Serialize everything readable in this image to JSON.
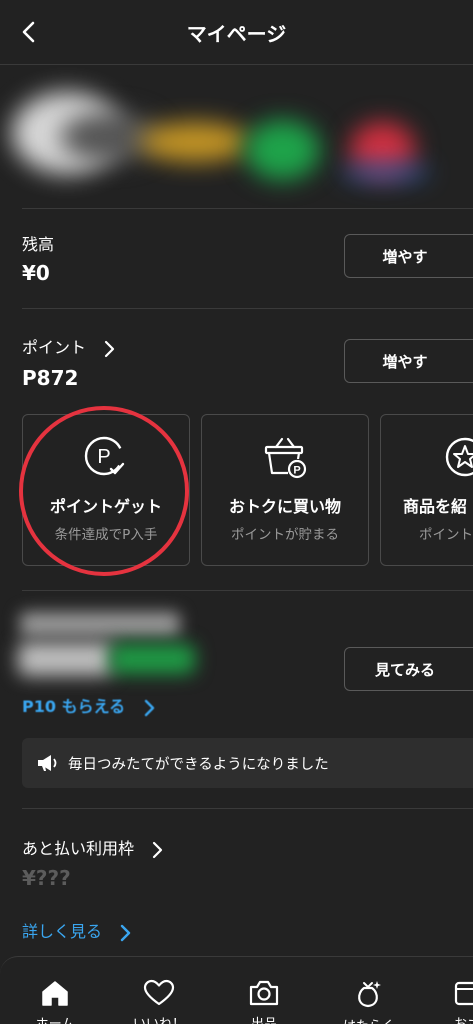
{
  "header": {
    "title": "マイページ"
  },
  "balance": {
    "label": "残高",
    "value": "¥0",
    "button_label": "増やす"
  },
  "points": {
    "label": "ポイント",
    "value": "P872",
    "button_label": "増やす",
    "cards": [
      {
        "title": "ポイントゲット",
        "subtitle": "条件達成でP入手",
        "icon": "point-check-icon"
      },
      {
        "title": "おトクに買い物",
        "subtitle": "ポイントが貯まる",
        "icon": "basket-point-icon"
      },
      {
        "title": "商品を紹",
        "subtitle": "ポイント",
        "icon": "star-badge-icon"
      }
    ]
  },
  "promo": {
    "link_label": "P10 もらえる",
    "button_label": "見てみる",
    "notice_text": "毎日つみたてができるようになりました",
    "notice_icon": "megaphone-icon"
  },
  "credit": {
    "label": "あと払い利用枠",
    "value": "¥???",
    "link_label": "詳しく見る"
  },
  "nav": {
    "items": [
      {
        "label": "ホーム",
        "icon": "home-icon"
      },
      {
        "label": "いいね！",
        "icon": "heart-icon"
      },
      {
        "label": "出品",
        "icon": "camera-icon"
      },
      {
        "label": "はたらく",
        "icon": "money-bag-icon"
      },
      {
        "label": "おさ",
        "icon": "wallet-icon"
      }
    ]
  },
  "colors": {
    "background": "#222222",
    "accent_link": "#3aa6f0",
    "highlight_ring": "#e5333f"
  }
}
